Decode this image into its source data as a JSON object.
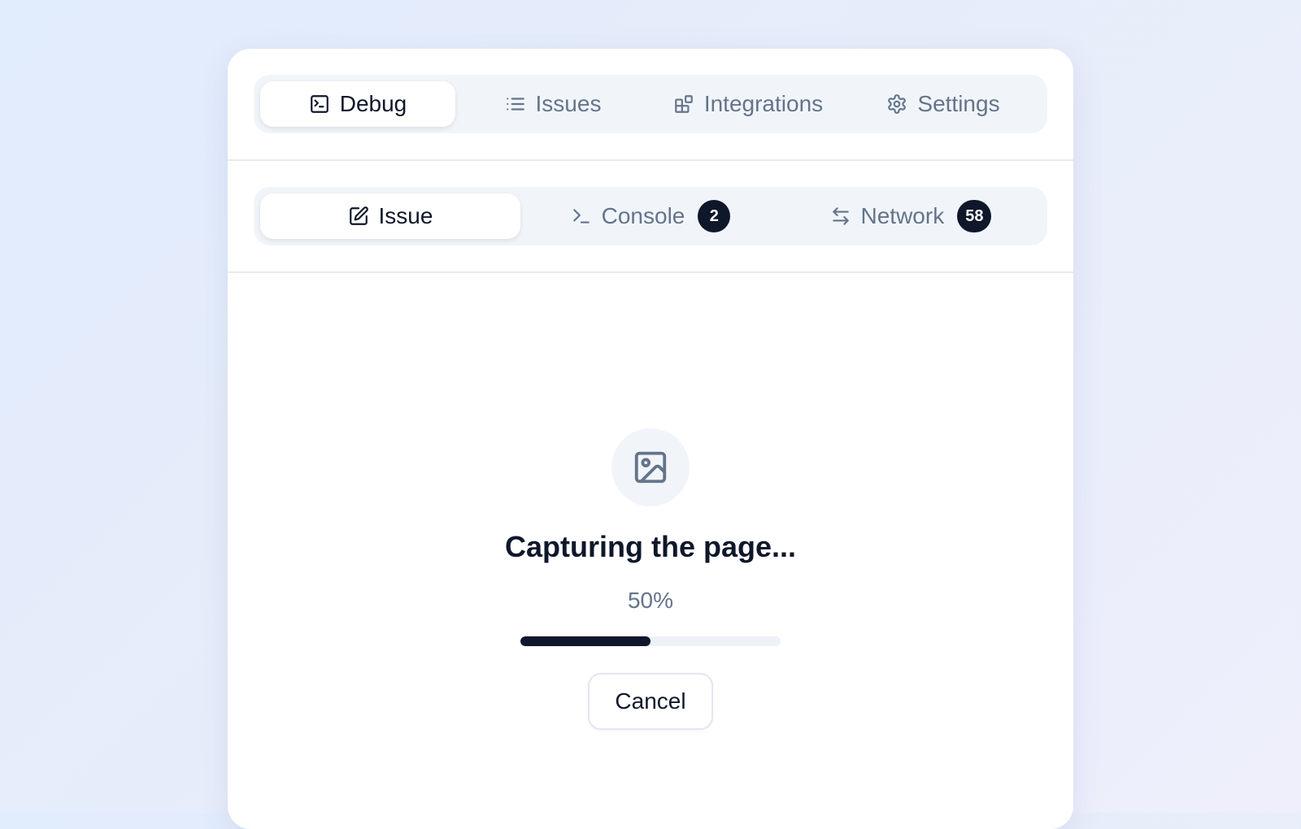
{
  "top_tabs": [
    {
      "label": "Debug",
      "icon": "terminal-square-icon",
      "active": true
    },
    {
      "label": "Issues",
      "icon": "list-icon",
      "active": false
    },
    {
      "label": "Integrations",
      "icon": "blocks-icon",
      "active": false
    },
    {
      "label": "Settings",
      "icon": "gear-icon",
      "active": false
    }
  ],
  "sub_tabs": [
    {
      "label": "Issue",
      "icon": "edit-icon",
      "active": true
    },
    {
      "label": "Console",
      "icon": "terminal-icon",
      "active": false,
      "badge": "2"
    },
    {
      "label": "Network",
      "icon": "arrows-left-right-icon",
      "active": false,
      "badge": "58"
    }
  ],
  "capture": {
    "icon": "image-icon",
    "title": "Capturing the page...",
    "percent_text": "50%",
    "progress": 0.5,
    "cancel_label": "Cancel"
  },
  "colors": {
    "accent": "#0f172a",
    "muted_text": "#64748b",
    "tab_background": "#f1f5f9",
    "badge_background": "#0f172a"
  }
}
